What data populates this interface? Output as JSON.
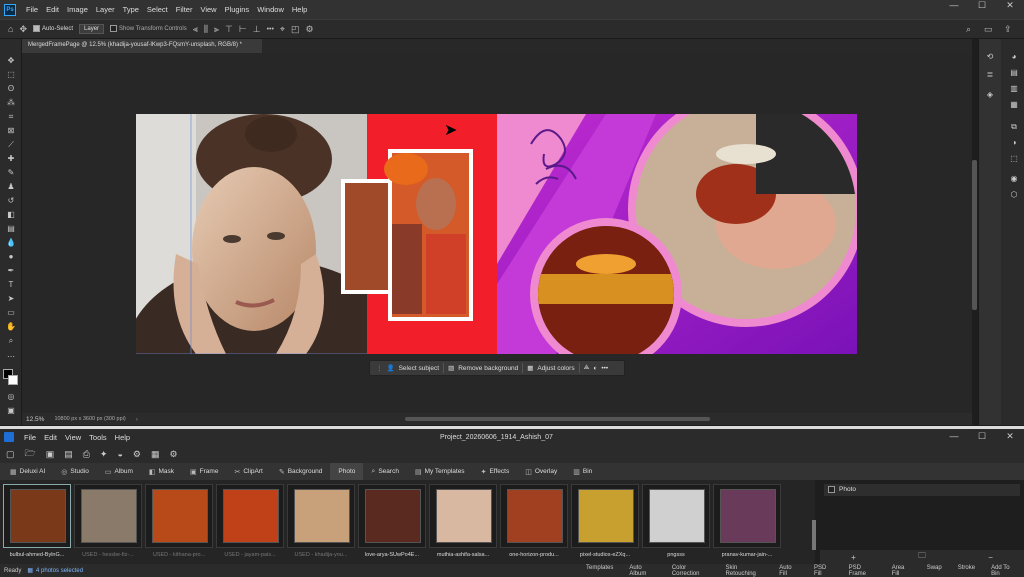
{
  "ps": {
    "logo": "Ps",
    "menu": [
      "File",
      "Edit",
      "Image",
      "Layer",
      "Type",
      "Select",
      "Filter",
      "View",
      "Plugins",
      "Window",
      "Help"
    ],
    "options": {
      "auto_select_label": "Auto-Select",
      "layer_value": "Layer",
      "transform_controls_label": "Show Transform Controls",
      "more_label": "•••"
    },
    "document_tab": "MergedFramePage @ 12.5% (khadija-yousaf-lKwp3-FQsmY-unsplash, RGB/8) *",
    "status": {
      "zoom": "12.5%",
      "doc_size": "10800 px x 3600 px (300 ppi)"
    },
    "context_bar": {
      "select_subject": "Select subject",
      "remove_background": "Remove background",
      "adjust_colors": "Adjust colors"
    }
  },
  "album": {
    "menu": [
      "File",
      "Edit",
      "View",
      "Tools",
      "Help"
    ],
    "window_title": "Project_20260606_1914_Ashish_07",
    "tabs": [
      "Deluxi AI",
      "Studio",
      "Album",
      "Mask",
      "Frame",
      "ClipArt",
      "Background",
      "Photo",
      "Search",
      "My Templates",
      "Effects",
      "Overlay",
      "Bin"
    ],
    "active_tab": "Photo",
    "thumbnails": [
      {
        "label": "bulbul-ahmed-BylnG...",
        "used": false,
        "selected": true,
        "color": "#7a3a1a"
      },
      {
        "label": "USED - hessbe-fiz-...",
        "used": true,
        "selected": false,
        "color": "#8a7a6a"
      },
      {
        "label": "USED - kithana-pro...",
        "used": true,
        "selected": false,
        "color": "#b84a1a"
      },
      {
        "label": "USED - jayam-pais...",
        "used": true,
        "selected": false,
        "color": "#c04018"
      },
      {
        "label": "USED - khadija-you...",
        "used": true,
        "selected": false,
        "color": "#c8a07a"
      },
      {
        "label": "love-arya-SUwPo4E...",
        "used": false,
        "selected": false,
        "color": "#5a2a20"
      },
      {
        "label": "muthia-ashifa-salsa...",
        "used": false,
        "selected": false,
        "color": "#d8b8a0"
      },
      {
        "label": "one-horizon-produ...",
        "used": false,
        "selected": false,
        "color": "#a04020"
      },
      {
        "label": "pixel-studios-eZXq...",
        "used": false,
        "selected": false,
        "color": "#c8a030"
      },
      {
        "label": "pngsss",
        "used": false,
        "selected": false,
        "color": "#d0d0d0"
      },
      {
        "label": "pranav-kumar-jain-...",
        "used": false,
        "selected": false,
        "color": "#6a3a5a"
      }
    ],
    "bin": {
      "folder": "Photo",
      "add": "+",
      "remove": "−"
    },
    "status": {
      "ready": "Ready",
      "selection": "4 photos selected",
      "actions": [
        "Templates",
        "Auto Album",
        "Color Correction",
        "Skin Retouching",
        "Auto Fill",
        "PSD Fill",
        "PSD Frame",
        "Area Fill",
        "Swap",
        "Stroke",
        "Add To Bin"
      ]
    }
  },
  "colors": {
    "ps_accent": "#31a8ff",
    "album_accent": "#1d6fd6",
    "art_red": "#f21f2a",
    "art_purple": "#9a1fc4",
    "art_pink": "#f08ad0"
  }
}
